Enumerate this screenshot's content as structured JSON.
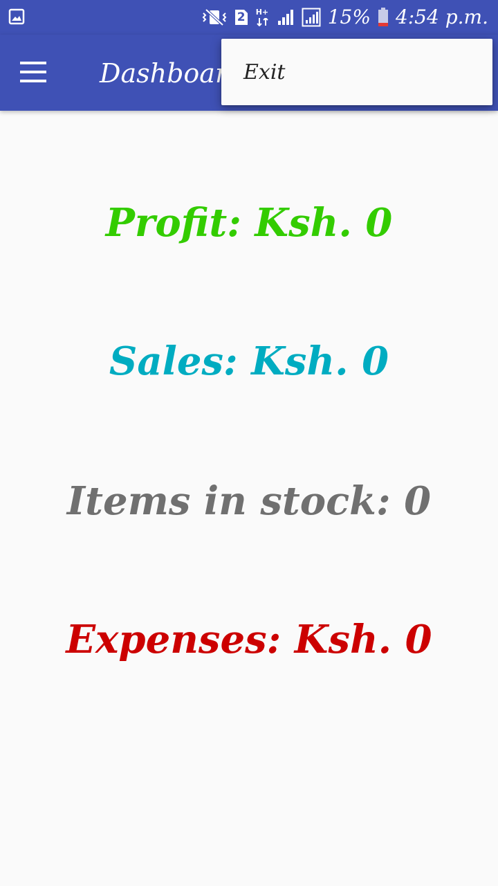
{
  "status_bar": {
    "sim_slot": "2",
    "network_type": "H+",
    "battery_percent": "15%",
    "time": "4:54 p.m.",
    "icons": [
      "gallery-icon",
      "vibrate-icon",
      "sim-2-icon",
      "data-hplus-icon",
      "signal-icon",
      "signal-icon",
      "battery-icon"
    ]
  },
  "app_bar": {
    "title": "Dashboard",
    "color": "#3f51b5"
  },
  "overflow_menu": {
    "items": [
      {
        "label": "Exit"
      }
    ]
  },
  "dashboard": {
    "profit": "Profit: Ksh. 0",
    "sales": "Sales: Ksh. 0",
    "items_in_stock": "Items in stock: 0",
    "expenses": "Expenses: Ksh. 0",
    "colors": {
      "profit": "#33cc00",
      "sales": "#00acc1",
      "items_in_stock": "#707070",
      "expenses": "#cc0000"
    }
  }
}
